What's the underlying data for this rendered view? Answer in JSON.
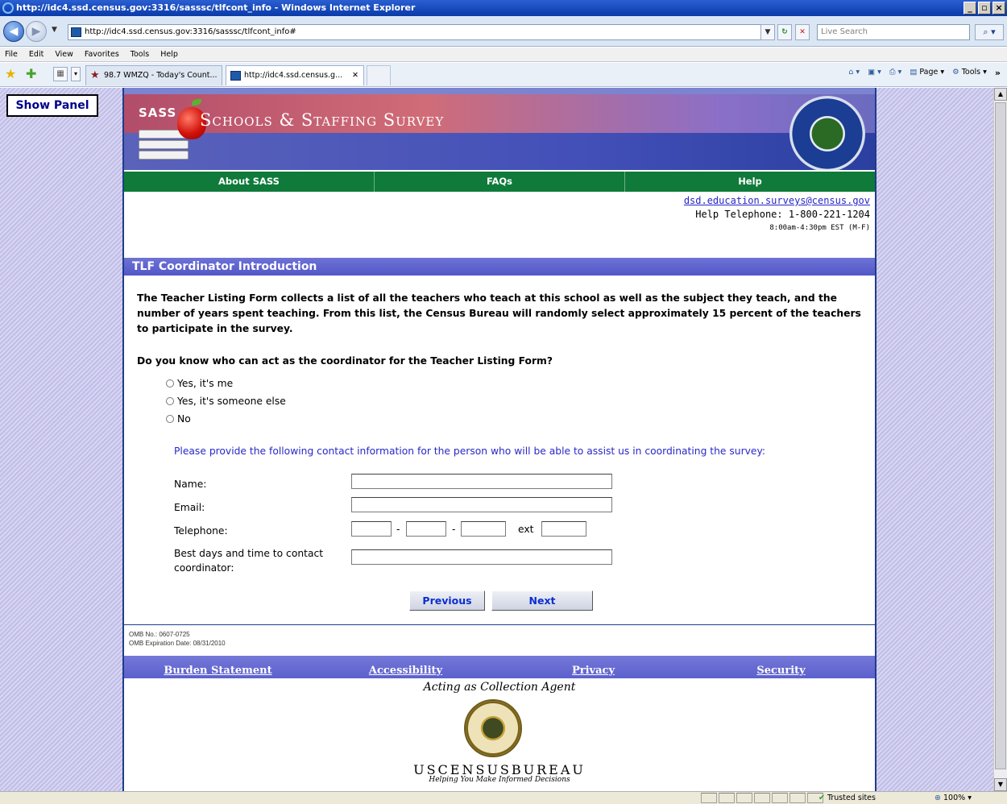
{
  "window": {
    "title": "http://idc4.ssd.census.gov:3316/sasssc/tlfcont_info - Windows Internet Explorer"
  },
  "browser": {
    "url": "http://idc4.ssd.census.gov:3316/sasssc/tlfcont_info#",
    "search_placeholder": "Live Search",
    "menu": [
      "File",
      "Edit",
      "View",
      "Favorites",
      "Tools",
      "Help"
    ],
    "tabs": [
      {
        "label": "98.7 WMZQ - Today's Count..."
      },
      {
        "label": "http://idc4.ssd.census.g..."
      }
    ],
    "command_bar": {
      "page_label": "Page",
      "tools_label": "Tools"
    },
    "status": {
      "zone": "Trusted sites",
      "zoom": "100%"
    }
  },
  "panel": {
    "show_label": "Show Panel"
  },
  "header": {
    "logo_text": "SASS",
    "site_title": "Schools & Staffing Survey"
  },
  "nav": {
    "items": [
      {
        "label": "About SASS"
      },
      {
        "label": "FAQs"
      },
      {
        "label": "Help"
      }
    ]
  },
  "contact": {
    "email": "dsd.education.surveys@census.gov",
    "phone": "Help Telephone: 1-800-221-1204",
    "hours": "8:00am-4:30pm EST (M-F)"
  },
  "section": {
    "title": "TLF Coordinator Introduction",
    "intro": "The Teacher Listing Form collects a list of all the teachers who teach at this school as well as the subject they teach, and the number of years spent teaching. From this list, the Census Bureau will randomly select approximately 15 percent of the teachers to participate in the survey.",
    "question": "Do you know who can act as the coordinator for the Teacher Listing Form?",
    "options": [
      {
        "label": "Yes, it's me"
      },
      {
        "label": "Yes, it's someone else"
      },
      {
        "label": "No"
      }
    ],
    "instruction": "Please provide the following contact information for the person who will be able to assist us in coordinating the survey:"
  },
  "form": {
    "name_label": "Name:",
    "email_label": "Email:",
    "telephone_label": "Telephone:",
    "ext_label": "ext",
    "best_time_label": "Best days and time to contact coordinator:",
    "dash": "-",
    "values": {
      "name": "",
      "email": "",
      "tel1": "",
      "tel2": "",
      "tel3": "",
      "ext": "",
      "best_time": ""
    }
  },
  "buttons": {
    "previous": "Previous",
    "next": "Next"
  },
  "omb": {
    "number": "OMB No.: 0607-0725",
    "expiration": "OMB Expiration Date: 08/31/2010"
  },
  "footer": {
    "links": [
      {
        "label": "Burden Statement"
      },
      {
        "label": "Accessibility"
      },
      {
        "label": "Privacy"
      },
      {
        "label": "Security"
      }
    ],
    "agent_text": "Acting as Collection Agent",
    "bureau_name": "USCENSUSBUREAU",
    "bureau_tagline": "Helping You Make Informed Decisions"
  }
}
